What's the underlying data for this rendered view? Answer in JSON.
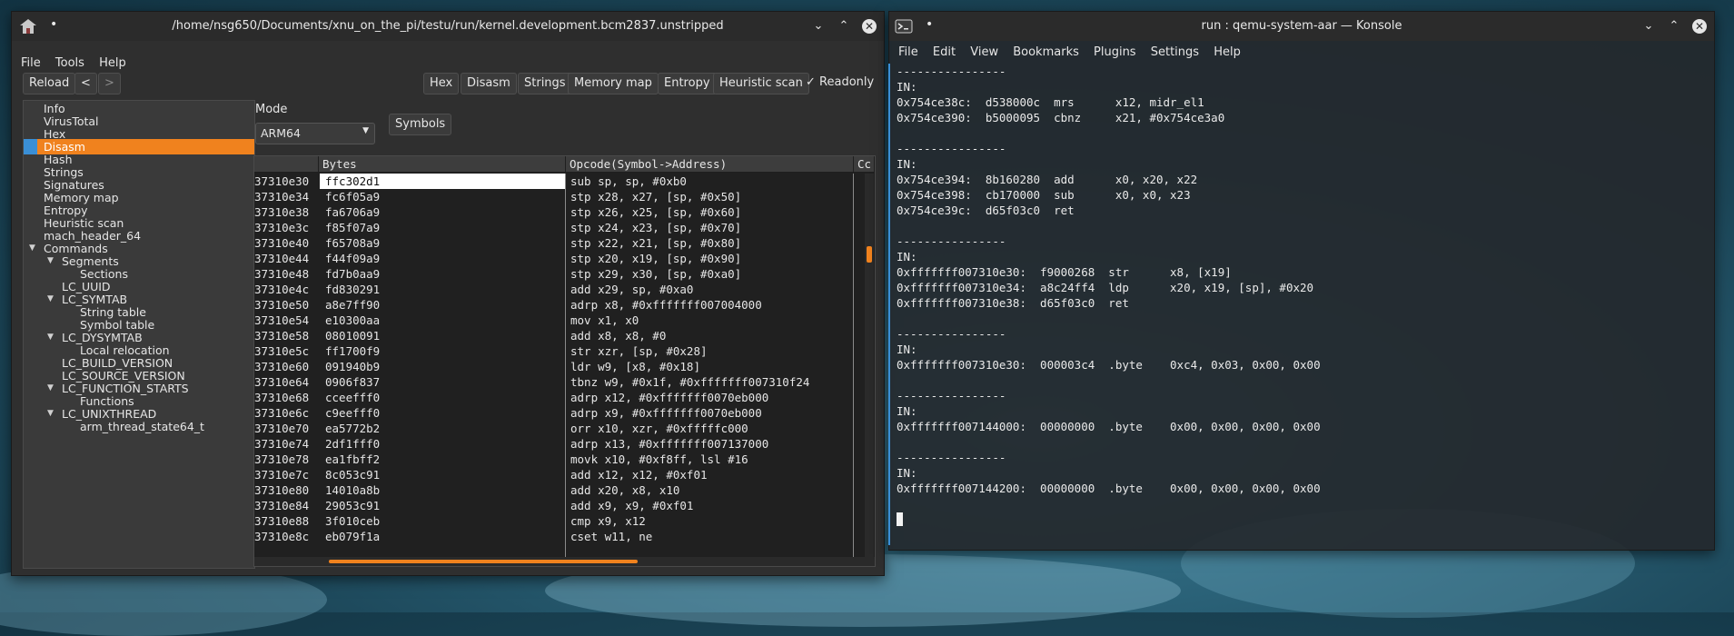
{
  "colors": {
    "accent": "#f0821e",
    "selection_marker": "#3a8fd6",
    "terminal_bg": "#1c242a"
  },
  "left_window": {
    "title": "/home/nsg650/Documents/xnu_on_the_pi/testu/run/kernel.development.bcm2837.unstripped",
    "app_icon": "house-icon",
    "menus": [
      "File",
      "Tools",
      "Help"
    ],
    "toolbar": {
      "reload": "Reload",
      "back": "<",
      "forward": ">",
      "hex": "Hex",
      "disasm": "Disasm",
      "strings": "Strings",
      "memory_map": "Memory map",
      "entropy": "Entropy",
      "heuristic_scan": "Heuristic scan",
      "readonly_check": "✓",
      "readonly": "Readonly"
    },
    "tree": [
      "Info",
      "VirusTotal",
      "Hex",
      "Disasm",
      "Hash",
      "Strings",
      "Signatures",
      "Memory map",
      "Entropy",
      "Heuristic scan",
      "mach_header_64",
      "Commands",
      "Segments",
      "Sections",
      "LC_UUID",
      "LC_SYMTAB",
      "String table",
      "Symbol table",
      "LC_DYSYMTAB",
      "Local relocation",
      "LC_BUILD_VERSION",
      "LC_SOURCE_VERSION",
      "LC_FUNCTION_STARTS",
      "Functions",
      "LC_UNIXTHREAD",
      "arm_thread_state64_t"
    ],
    "tree_selected": "Disasm",
    "mode_label": "Mode",
    "mode_value": "ARM64",
    "symbols_button": "Symbols",
    "table": {
      "headers": [
        "Bytes",
        "Opcode(Symbol->Address)",
        "Cc"
      ],
      "addresses": [
        "37310e30",
        "37310e34",
        "37310e38",
        "37310e3c",
        "37310e40",
        "37310e44",
        "37310e48",
        "37310e4c",
        "37310e50",
        "37310e54",
        "37310e58",
        "37310e5c",
        "37310e60",
        "37310e64",
        "37310e68",
        "37310e6c",
        "37310e70",
        "37310e74",
        "37310e78",
        "37310e7c",
        "37310e80",
        "37310e84",
        "37310e88",
        "37310e8c"
      ],
      "bytes": [
        "ffc302d1",
        "fc6f05a9",
        "fa6706a9",
        "f85f07a9",
        "f65708a9",
        "f44f09a9",
        "fd7b0aa9",
        "fd830291",
        "a8e7ff90",
        "e10300aa",
        "08010091",
        "ff1700f9",
        "091940b9",
        "0906f837",
        "cceefff0",
        "c9eefff0",
        "ea5772b2",
        "2df1fff0",
        "ea1fbff2",
        "8c053c91",
        "14010a8b",
        "29053c91",
        "3f010ceb",
        "eb079f1a"
      ],
      "opcodes": [
        "sub sp, sp, #0xb0",
        "stp x28, x27, [sp, #0x50]",
        "stp x26, x25, [sp, #0x60]",
        "stp x24, x23, [sp, #0x70]",
        "stp x22, x21, [sp, #0x80]",
        "stp x20, x19, [sp, #0x90]",
        "stp x29, x30, [sp, #0xa0]",
        "add x29, sp, #0xa0",
        "adrp x8, #0xfffffff007004000",
        "mov x1, x0",
        "add x8, x8, #0",
        "str xzr, [sp, #0x28]",
        "ldr w9, [x8, #0x18]",
        "tbnz w9, #0x1f, #0xfffffff007310f24",
        "adrp x12, #0xfffffff0070eb000",
        "adrp x9, #0xfffffff0070eb000",
        "orr x10, xzr, #0xfffffc000",
        "adrp x13, #0xfffffff007137000",
        "movk x10, #0xf8ff, lsl #16",
        "add x12, x12, #0xf01",
        "add x20, x8, x10",
        "add x9, x9, #0xf01",
        "cmp x9, x12",
        "cset w11, ne"
      ]
    }
  },
  "right_window": {
    "title": "run : qemu-system-aar — Konsole",
    "app_icon": "terminal-icon",
    "menus": [
      "File",
      "Edit",
      "View",
      "Bookmarks",
      "Plugins",
      "Settings",
      "Help"
    ],
    "lines": [
      "----------------",
      "IN:",
      "0x754ce38c:  d538000c  mrs      x12, midr_el1",
      "0x754ce390:  b5000095  cbnz     x21, #0x754ce3a0",
      "",
      "----------------",
      "IN:",
      "0x754ce394:  8b160280  add      x0, x20, x22",
      "0x754ce398:  cb170000  sub      x0, x0, x23",
      "0x754ce39c:  d65f03c0  ret",
      "",
      "----------------",
      "IN:",
      "0xfffffff007310e30:  f9000268  str      x8, [x19]",
      "0xfffffff007310e34:  a8c24ff4  ldp      x20, x19, [sp], #0x20",
      "0xfffffff007310e38:  d65f03c0  ret",
      "",
      "----------------",
      "IN:",
      "0xfffffff007310e30:  000003c4  .byte    0xc4, 0x03, 0x00, 0x00",
      "",
      "----------------",
      "IN:",
      "0xfffffff007144000:  00000000  .byte    0x00, 0x00, 0x00, 0x00",
      "",
      "----------------",
      "IN:",
      "0xfffffff007144200:  00000000  .byte    0x00, 0x00, 0x00, 0x00"
    ]
  }
}
